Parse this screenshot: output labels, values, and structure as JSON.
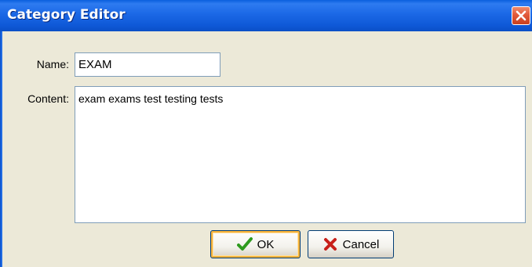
{
  "window": {
    "title": "Category Editor"
  },
  "form": {
    "name_label": "Name:",
    "name_value": "EXAM",
    "content_label": "Content:",
    "content_value": "exam exams test testing tests"
  },
  "buttons": {
    "ok_label": "OK",
    "cancel_label": "Cancel"
  },
  "icons": {
    "close": "close-icon",
    "ok": "checkmark-icon",
    "cancel": "x-mark-icon"
  },
  "colors": {
    "titlebar": "#0F59D8",
    "close_button": "#E2593A",
    "checkmark": "#2E9A1E",
    "cancel_x": "#C8201A",
    "dialog_background": "#ECE9D8"
  }
}
